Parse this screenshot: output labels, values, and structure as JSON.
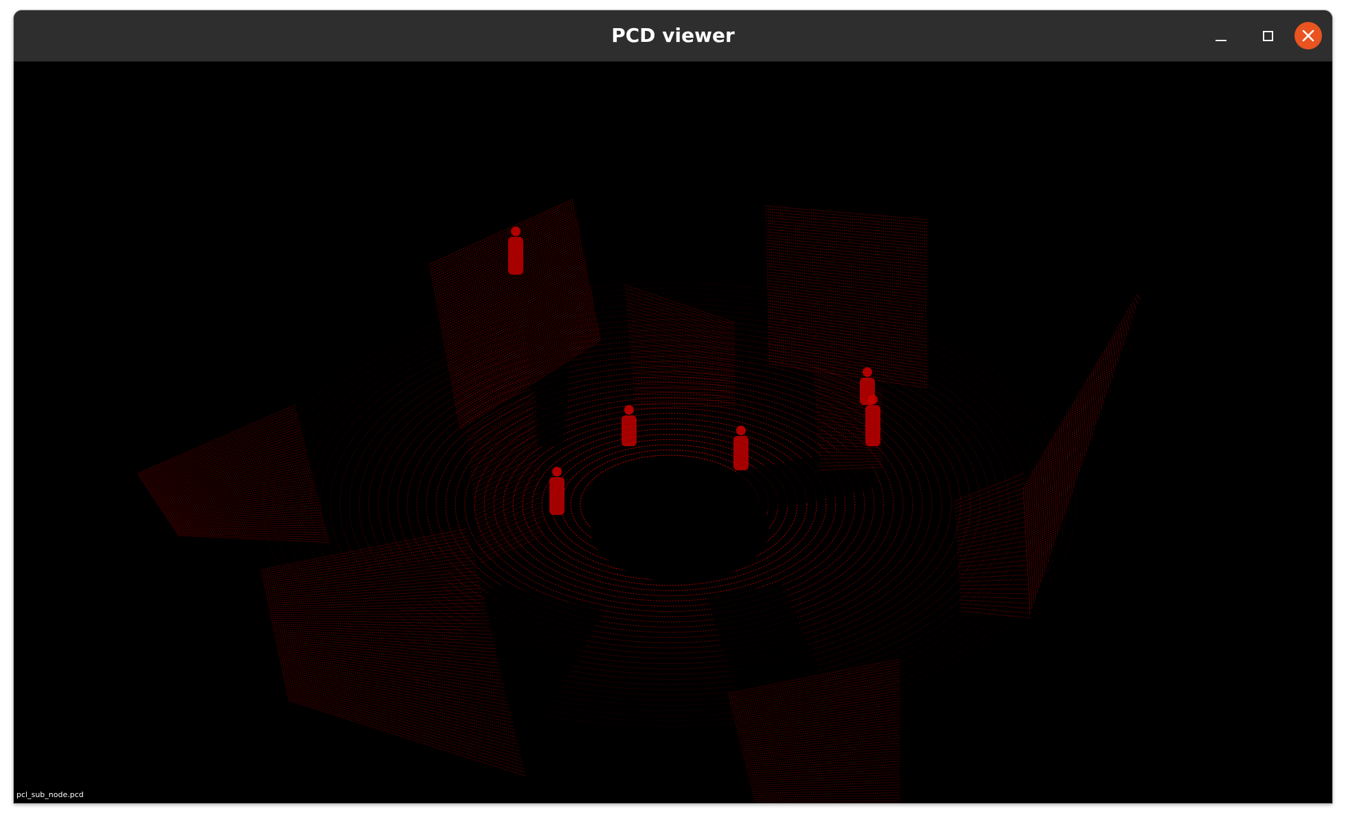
{
  "window": {
    "title": "PCD viewer",
    "titlebar_color": "#2e2e2e",
    "close_button_color": "#e95420"
  },
  "controls": {
    "minimize_icon": "minimize-icon",
    "maximize_icon": "maximize-icon",
    "close_icon": "close-icon"
  },
  "viewer": {
    "background_color": "#000000",
    "point_color": "#cc0000",
    "filename_label": "pcl_sub_node.pcd"
  }
}
